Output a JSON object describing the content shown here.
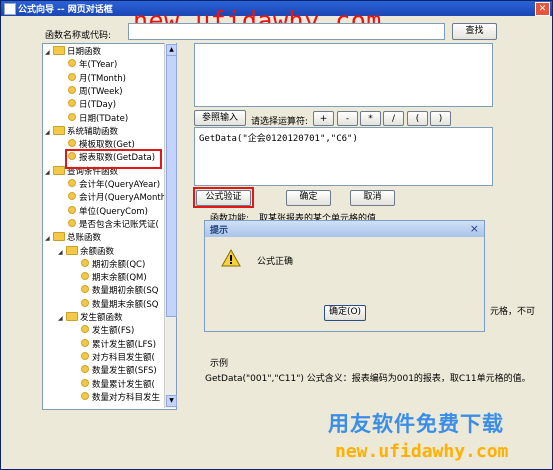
{
  "window": {
    "title": "公式向导 -- 网页对话框"
  },
  "watermark": {
    "top": "new.ufidawhy.com",
    "bottom_cn": "用友软件免费下载",
    "bottom_url": "new.ufidawhy.com"
  },
  "search": {
    "label": "函数名称或代码:",
    "value": "",
    "button": "查找"
  },
  "tree": [
    {
      "label": "日期函数",
      "kind": "folder",
      "depth": 0,
      "expander": "◢"
    },
    {
      "label": "年(TYear)",
      "kind": "leaf",
      "depth": 1
    },
    {
      "label": "月(TMonth)",
      "kind": "leaf",
      "depth": 1
    },
    {
      "label": "周(TWeek)",
      "kind": "leaf",
      "depth": 1
    },
    {
      "label": "日(TDay)",
      "kind": "leaf",
      "depth": 1
    },
    {
      "label": "日期(TDate)",
      "kind": "leaf",
      "depth": 1
    },
    {
      "label": "系统辅助函数",
      "kind": "folder",
      "depth": 0,
      "expander": "◢"
    },
    {
      "label": "模板取数(Get)",
      "kind": "leaf",
      "depth": 1
    },
    {
      "label": "报表取数(GetData)",
      "kind": "leaf",
      "depth": 1,
      "selected": true
    },
    {
      "label": "查询条件函数",
      "kind": "folder",
      "depth": 0,
      "expander": "◢"
    },
    {
      "label": "会计年(QueryAYear)",
      "kind": "leaf",
      "depth": 1
    },
    {
      "label": "会计月(QueryAMonth)",
      "kind": "leaf",
      "depth": 1
    },
    {
      "label": "单位(QueryCom)",
      "kind": "leaf",
      "depth": 1
    },
    {
      "label": "是否包含未记账凭证(",
      "kind": "leaf",
      "depth": 1
    },
    {
      "label": "总账函数",
      "kind": "folder",
      "depth": 0,
      "expander": "◢"
    },
    {
      "label": "余额函数",
      "kind": "folder",
      "depth": 1,
      "expander": "◢"
    },
    {
      "label": "期初余额(QC)",
      "kind": "leaf",
      "depth": 2
    },
    {
      "label": "期末余额(QM)",
      "kind": "leaf",
      "depth": 2
    },
    {
      "label": "数量期初余额(SQ",
      "kind": "leaf",
      "depth": 2
    },
    {
      "label": "数量期末余额(SQ",
      "kind": "leaf",
      "depth": 2
    },
    {
      "label": "发生额函数",
      "kind": "folder",
      "depth": 1,
      "expander": "◢"
    },
    {
      "label": "发生额(FS)",
      "kind": "leaf",
      "depth": 2
    },
    {
      "label": "累计发生额(LFS)",
      "kind": "leaf",
      "depth": 2
    },
    {
      "label": "对方科目发生额(",
      "kind": "leaf",
      "depth": 2
    },
    {
      "label": "数量发生额(SFS)",
      "kind": "leaf",
      "depth": 2
    },
    {
      "label": "数量累计发生额(",
      "kind": "leaf",
      "depth": 2
    },
    {
      "label": "数量对方科目发生",
      "kind": "leaf",
      "depth": 2
    }
  ],
  "params_button": "参照输入",
  "operator_label": "请选择运算符:",
  "operators": [
    "+",
    "-",
    "*",
    "/",
    "(",
    ")"
  ],
  "formula": "GetData(\"企会0120120701\",\"C6\")",
  "actions": {
    "validate": "公式验证",
    "ok": "确定",
    "cancel": "取消"
  },
  "function_desc": {
    "label": "函数功能:",
    "text": "取某张报表的某个单元格的值",
    "trailing": "元格，不可"
  },
  "example": {
    "label": "示例",
    "text": "GetData(\"001\",\"C11\") 公式含义：报表编码为001的报表，取C11单元格的值。"
  },
  "alert": {
    "title": "提示",
    "message": "公式正确",
    "ok": "确定(O)",
    "close": "×"
  }
}
